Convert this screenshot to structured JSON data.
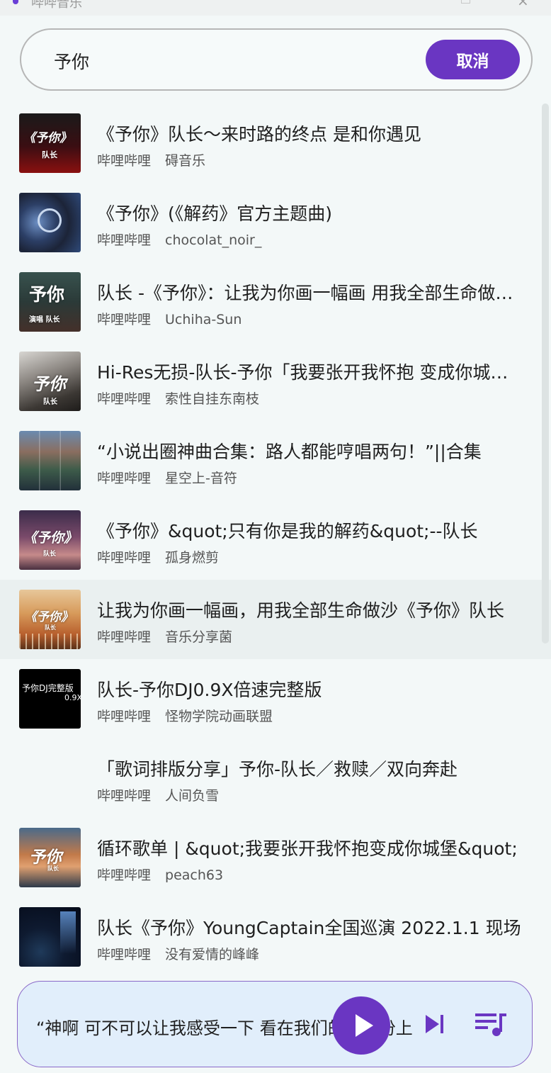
{
  "window": {
    "title": "哔哔音乐"
  },
  "search": {
    "query": "予你",
    "cancel_label": "取消"
  },
  "results": [
    {
      "title": "《予你》队长～来时路的终点 是和你遇见",
      "source": "哔哩哔哩",
      "uploader": "碍音乐",
      "cover_text": "《予你》",
      "cover_sub": "队长"
    },
    {
      "title": "《予你》(《解药》官方主题曲)",
      "source": "哔哩哔哩",
      "uploader": "chocolat_noir_",
      "cover_text": "",
      "cover_sub": ""
    },
    {
      "title": "队长 -《予你》：让我为你画一幅画 用我全部生命做沙 你可以看到我",
      "source": "哔哩哔哩",
      "uploader": "Uchiha-Sun",
      "cover_text": "予你",
      "cover_sub": "演唱 队长"
    },
    {
      "title": "Hi-Res无损-队长-予你「我要张开我怀抱 变成你城堡」",
      "source": "哔哩哔哩",
      "uploader": "索性自挂东南枝",
      "cover_text": "予你",
      "cover_sub": "队长"
    },
    {
      "title": "“小说出圈神曲合集：路人都能哼唱两句！”||合集",
      "source": "哔哩哔哩",
      "uploader": "星空上-音符",
      "cover_text": "",
      "cover_sub": ""
    },
    {
      "title": "《予你》&quot;只有你是我的解药&quot;--队长",
      "source": "哔哩哔哩",
      "uploader": "孤身燃剪",
      "cover_text": "《予你》",
      "cover_sub": "队长"
    },
    {
      "title": "让我为你画一幅画，用我全部生命做沙《予你》队长",
      "source": "哔哩哔哩",
      "uploader": "音乐分享菌",
      "cover_text": "《予你》",
      "cover_sub": "队长"
    },
    {
      "title": "队长-予你DJ0.9X倍速完整版",
      "source": "哔哩哔哩",
      "uploader": "怪物学院动画联盟",
      "cover_text": "予你DJ完整版",
      "cover_sub": "0.9X"
    },
    {
      "title": "「歌词排版分享」予你-队长／救赎／双向奔赴",
      "source": "哔哩哔哩",
      "uploader": "人间负雪",
      "cover_text": "",
      "cover_sub": ""
    },
    {
      "title": "循环歌单 | &quot;我要张开我怀抱变成你城堡&quot;",
      "source": "哔哩哔哩",
      "uploader": "peach63",
      "cover_text": "予你",
      "cover_sub": "队长"
    },
    {
      "title": "队长《予你》YoungCaptain全国巡演 2022.1.1 现场",
      "source": "哔哩哔哩",
      "uploader": "没有爱情的峰峰",
      "cover_text": "",
      "cover_sub": ""
    }
  ],
  "player": {
    "now_playing": "“神啊 可不可以让我感受一下 看在我们的爱的份上"
  },
  "icons": {
    "play": "play-icon",
    "next": "skip-next-icon",
    "queue": "playlist-icon"
  },
  "colors": {
    "accent": "#6a36c2",
    "background": "#f3f8f8",
    "player_bg": "#e1eefb"
  }
}
